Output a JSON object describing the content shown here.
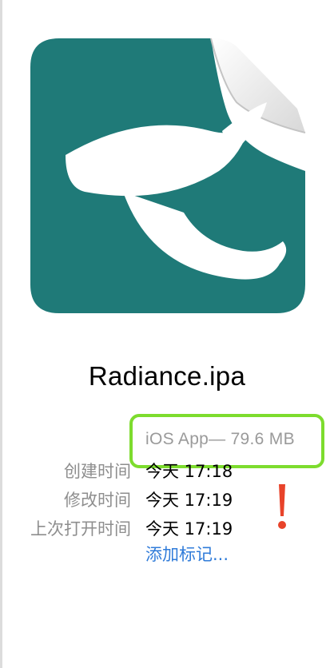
{
  "file": {
    "name": "Radiance.ipa",
    "kind_size": "iOS App— 79.6 MB"
  },
  "info": [
    {
      "label": "创建时间",
      "value": "今天 17:18"
    },
    {
      "label": "修改时间",
      "value": "今天 17:19"
    },
    {
      "label": "上次打开时间",
      "value": "今天 17:19"
    }
  ],
  "add_tags_label": "添加标记...",
  "colors": {
    "icon_teal": "#1f7a78",
    "highlight_green": "#7ddc2e",
    "exclamation_red": "#e8432a",
    "link_blue": "#2f7bd9"
  },
  "icons": {
    "file_icon": "app-document-icon",
    "annotation": "exclamation-icon"
  }
}
